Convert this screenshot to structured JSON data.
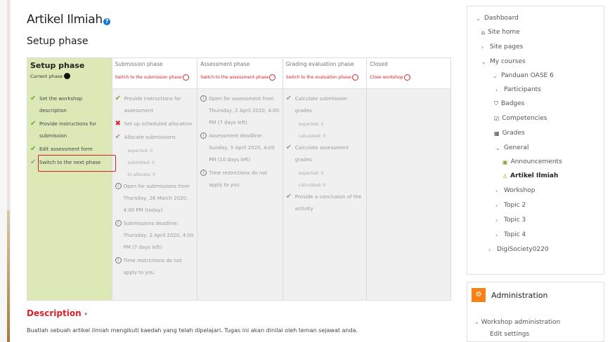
{
  "page": {
    "title": "Artikel Ilmiah",
    "help_icon": "?",
    "section_title": "Setup phase"
  },
  "phases": [
    {
      "name": "Setup phase",
      "switch_label": "Current phase",
      "active": true,
      "tasks": [
        {
          "icon": "check",
          "text": "Set the workshop description"
        },
        {
          "icon": "check",
          "text": "Provide instructions for submission"
        },
        {
          "icon": "check",
          "text": "Edit assessment form"
        },
        {
          "icon": "grey-check",
          "text": "Switch to the next phase"
        }
      ]
    },
    {
      "name": "Submission phase",
      "switch_label": "Switch to the submission phase",
      "tasks": [
        {
          "icon": "check",
          "text": "Provide instructions for assessment"
        },
        {
          "icon": "cross",
          "text": "Set up scheduled allocation"
        },
        {
          "icon": "grey-check",
          "text": "Allocate submissions",
          "subs": [
            "expected: 0",
            "submitted: 0",
            "to allocate: 0"
          ]
        },
        {
          "icon": "info",
          "text": "Open for submissions from Thursday, 26 March 2020, 4:00 PM (today)"
        },
        {
          "icon": "info",
          "text": "Submissions deadline: Thursday, 2 April 2020, 4:00 PM (7 days left)"
        },
        {
          "icon": "info",
          "text": "Time restrictions do not apply to you"
        }
      ]
    },
    {
      "name": "Assessment phase",
      "switch_label": "Switch to the assessment phase",
      "tasks": [
        {
          "icon": "info",
          "text": "Open for assessment from Thursday, 2 April 2020, 4:00 PM (7 days left)"
        },
        {
          "icon": "info",
          "text": "Assessment deadline: Sunday, 5 April 2020, 4:00 PM (10 days left)"
        },
        {
          "icon": "info",
          "text": "Time restrictions do not apply to you"
        }
      ]
    },
    {
      "name": "Grading evaluation phase",
      "switch_label": "Switch to the evaluation phase",
      "tasks": [
        {
          "icon": "grey-check",
          "text": "Calculate submission grades",
          "subs": [
            "expected: 0",
            "calculated: 0"
          ]
        },
        {
          "icon": "grey-check",
          "text": "Calculate assessment grades",
          "subs": [
            "expected: 0",
            "calculated: 0"
          ]
        },
        {
          "icon": "grey-check",
          "text": "Provide a conclusion of the activity"
        }
      ]
    },
    {
      "name": "Closed",
      "switch_label": "Close workshop",
      "tasks": []
    }
  ],
  "description": {
    "heading": "Description",
    "toggle_icon": "▾",
    "text": "Buatlah sebuah artikel ilmiah mengikuti kaedah yang telah dipelajari. Tugas ini akan dinilai oleh teman sejawat anda."
  },
  "navigation": {
    "items": [
      {
        "label": "Dashboard",
        "chev": "⌄"
      },
      {
        "label": "Site home",
        "icon": "home-icon",
        "glyph": "⌂"
      },
      {
        "label": "Site pages",
        "chev": "›"
      },
      {
        "label": "My courses",
        "chev": "⌄"
      },
      {
        "label": "Panduan OASE 6",
        "chev": "⌄"
      },
      {
        "label": "Participants",
        "chev": "›"
      },
      {
        "label": "Badges",
        "icon": "badge-icon",
        "glyph": "⛉"
      },
      {
        "label": "Competencies",
        "icon": "competencies-icon",
        "glyph": "☑"
      },
      {
        "label": "Grades",
        "icon": "grades-icon",
        "glyph": "▦"
      },
      {
        "label": "General",
        "chev": "⌄"
      },
      {
        "label": "Announcements",
        "icon": "forum-icon",
        "glyph": "▣"
      },
      {
        "label": "Artikel Ilmiah",
        "icon": "workshop-icon",
        "glyph": "♙",
        "bold": true
      },
      {
        "label": "Workshop",
        "chev": "›"
      },
      {
        "label": "Topic 2",
        "chev": "›"
      },
      {
        "label": "Topic 3",
        "chev": "›"
      },
      {
        "label": "Topic 4",
        "chev": "›"
      },
      {
        "label": "DigiSociety0220",
        "chev": "›"
      }
    ]
  },
  "administration": {
    "title": "Administration",
    "icon": "⚙",
    "items": [
      {
        "label": "Workshop administration",
        "chev": "⌄"
      },
      {
        "label": "Edit settings"
      }
    ]
  },
  "colors": {
    "active_phase": "#dce9b6",
    "switch_red": "#d9222a",
    "check_green": "#69a83a",
    "admin_orange": "#f98012"
  }
}
